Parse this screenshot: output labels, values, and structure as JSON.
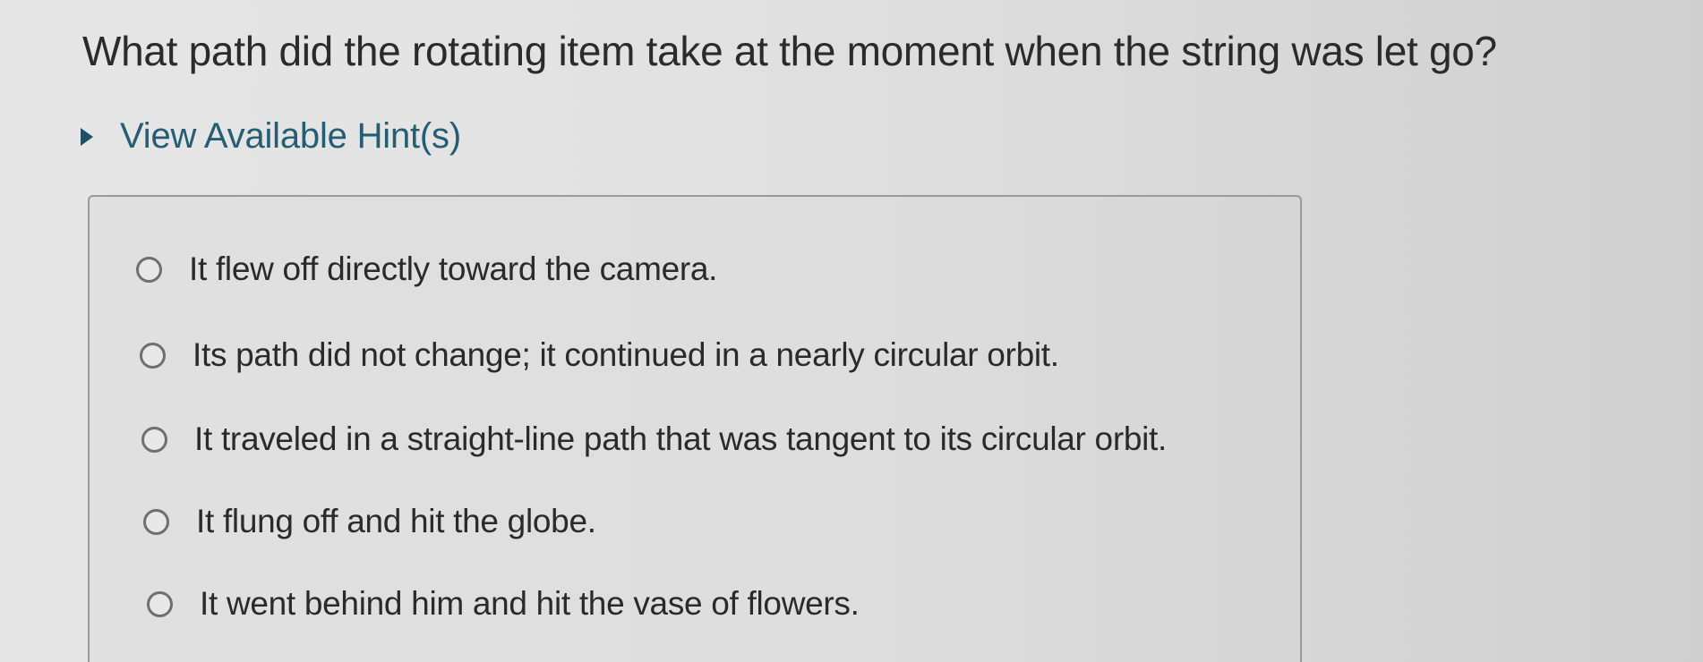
{
  "question": {
    "text": "What path did the rotating item take at the moment when the string was let go?"
  },
  "hints": {
    "label": "View Available Hint(s)",
    "icon": "caret-right-icon"
  },
  "choices": [
    {
      "label": "It flew off directly toward the camera."
    },
    {
      "label": "Its path did not change; it continued in a nearly circular orbit."
    },
    {
      "label": "It traveled in a straight-line path that was tangent to its circular orbit."
    },
    {
      "label": "It flung off and hit the globe."
    },
    {
      "label": "It went behind him and hit the vase of flowers."
    }
  ]
}
